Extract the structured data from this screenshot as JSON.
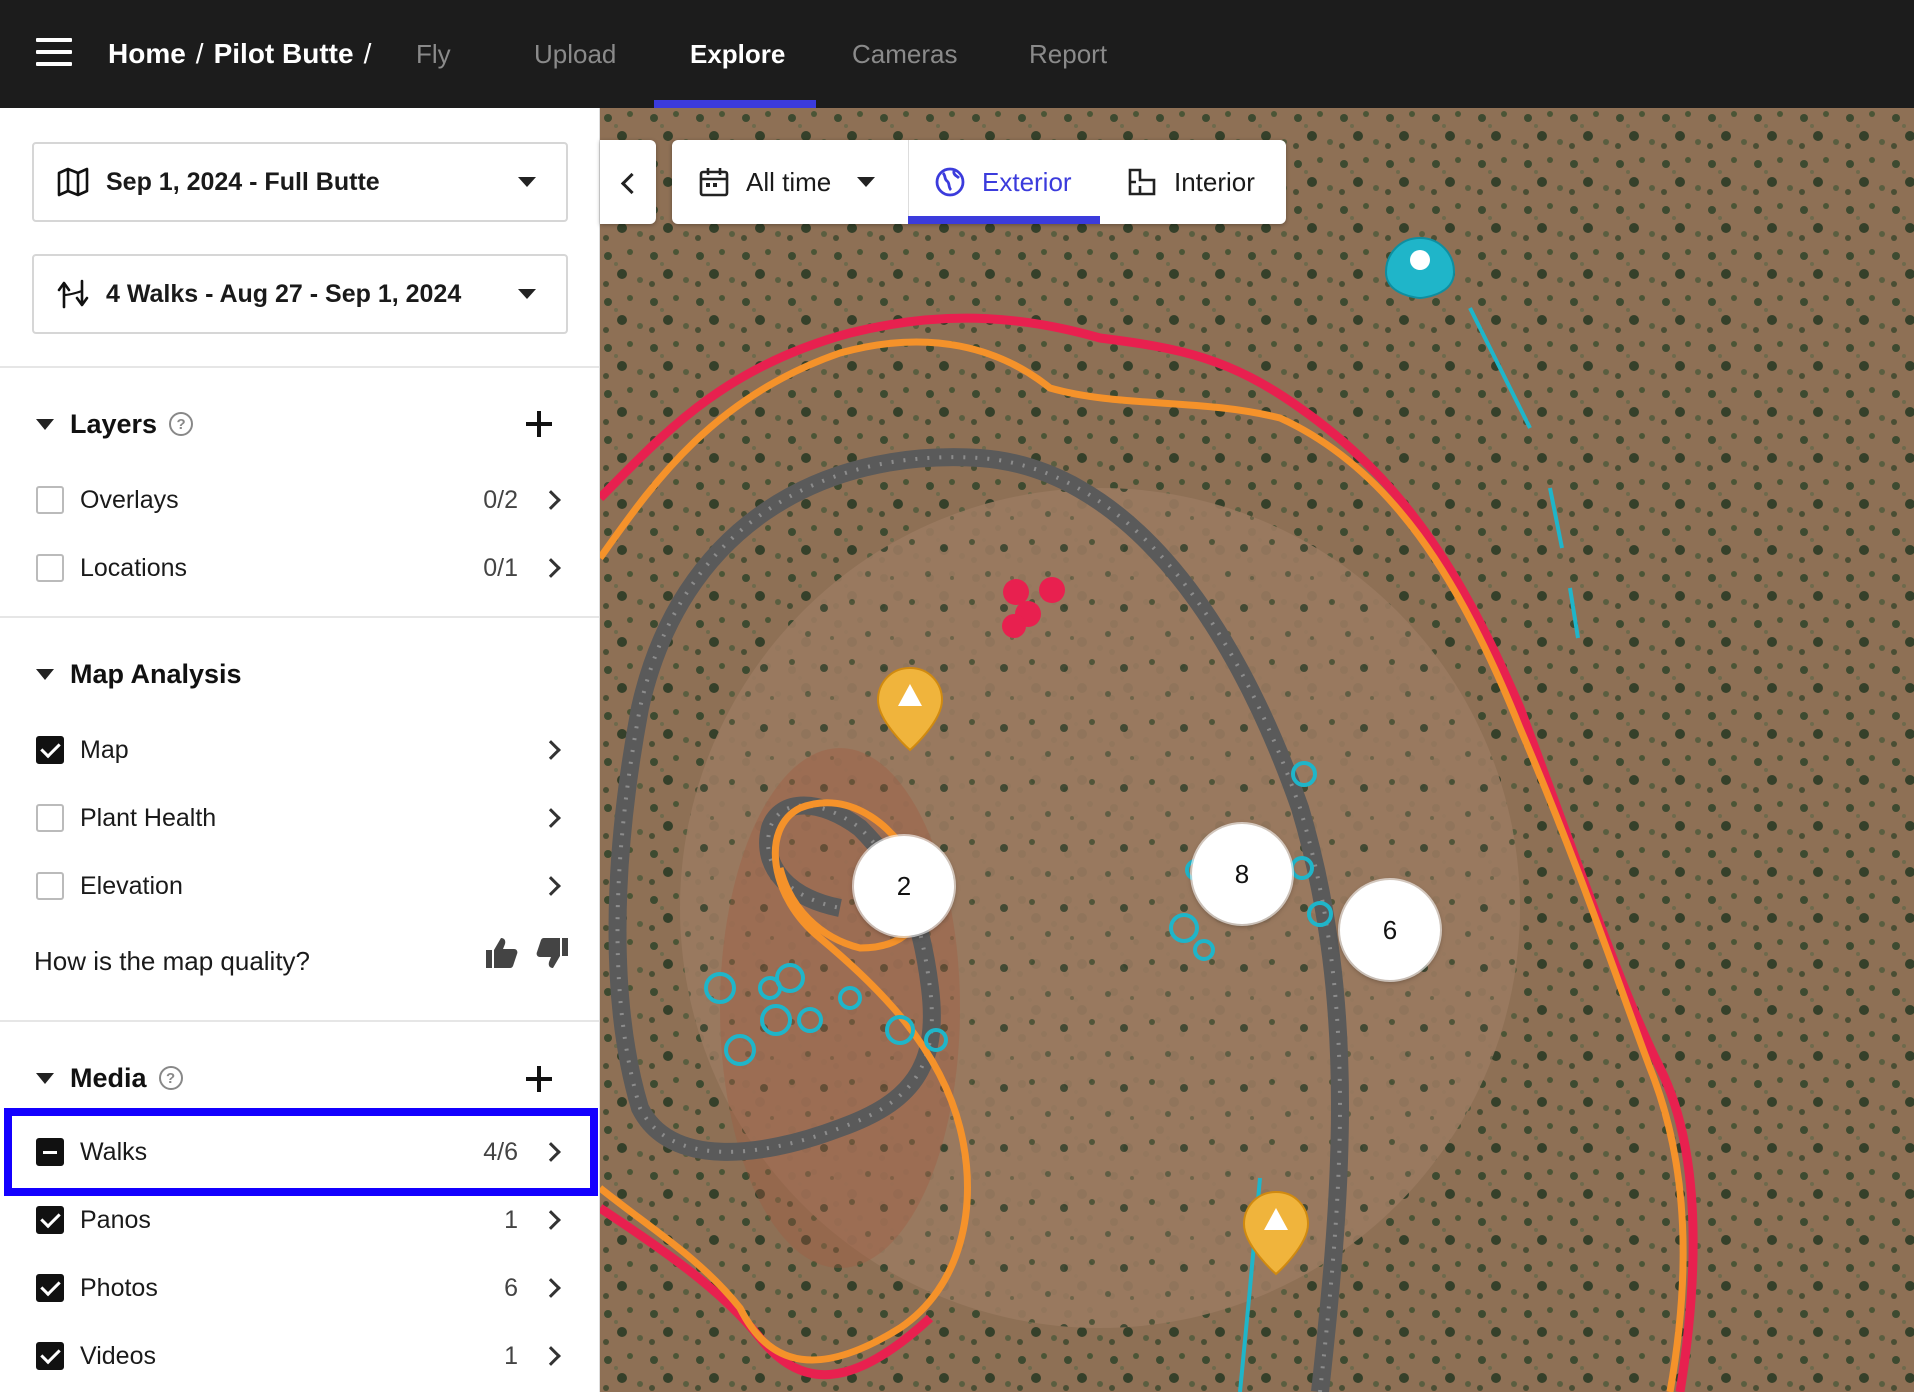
{
  "nav": {
    "breadcrumb": {
      "home": "Home",
      "separator": "/",
      "site": "Pilot Butte",
      "trailing": "/"
    },
    "tabs": [
      {
        "label": "Fly",
        "active": false
      },
      {
        "label": "Upload",
        "active": false
      },
      {
        "label": "Explore",
        "active": true
      },
      {
        "label": "Cameras",
        "active": false
      },
      {
        "label": "Report",
        "active": false
      }
    ]
  },
  "sidebar": {
    "map_select": {
      "label": "Sep 1, 2024 - Full Butte",
      "icon": "map-icon"
    },
    "walk_select": {
      "label": "4 Walks - Aug 27 - Sep 1, 2024",
      "icon": "walk-path-icon"
    },
    "layers": {
      "title": "Layers",
      "items": [
        {
          "label": "Overlays",
          "count": "0/2",
          "state": "unchecked"
        },
        {
          "label": "Locations",
          "count": "0/1",
          "state": "unchecked"
        }
      ]
    },
    "map_analysis": {
      "title": "Map Analysis",
      "items": [
        {
          "label": "Map",
          "state": "checked"
        },
        {
          "label": "Plant Health",
          "state": "unchecked"
        },
        {
          "label": "Elevation",
          "state": "unchecked"
        }
      ],
      "quality_question": "How is the map quality?"
    },
    "media": {
      "title": "Media",
      "items": [
        {
          "label": "Walks",
          "count": "4/6",
          "state": "indeterminate"
        },
        {
          "label": "Panos",
          "count": "1",
          "state": "checked"
        },
        {
          "label": "Photos",
          "count": "6",
          "state": "checked"
        },
        {
          "label": "Videos",
          "count": "1",
          "state": "checked"
        }
      ]
    }
  },
  "map_toolbar": {
    "time_filter": "All time",
    "exterior": "Exterior",
    "interior": "Interior",
    "active_view": "Exterior"
  },
  "map": {
    "clusters": [
      "2",
      "8",
      "6"
    ]
  },
  "colors": {
    "accent": "#3b3bdc",
    "walk_red": "#e8204f",
    "walk_orange": "#f5922a",
    "pano_teal": "#1fb5c9",
    "warning_yellow": "#f0b43c",
    "highlight": "#1400ff"
  }
}
